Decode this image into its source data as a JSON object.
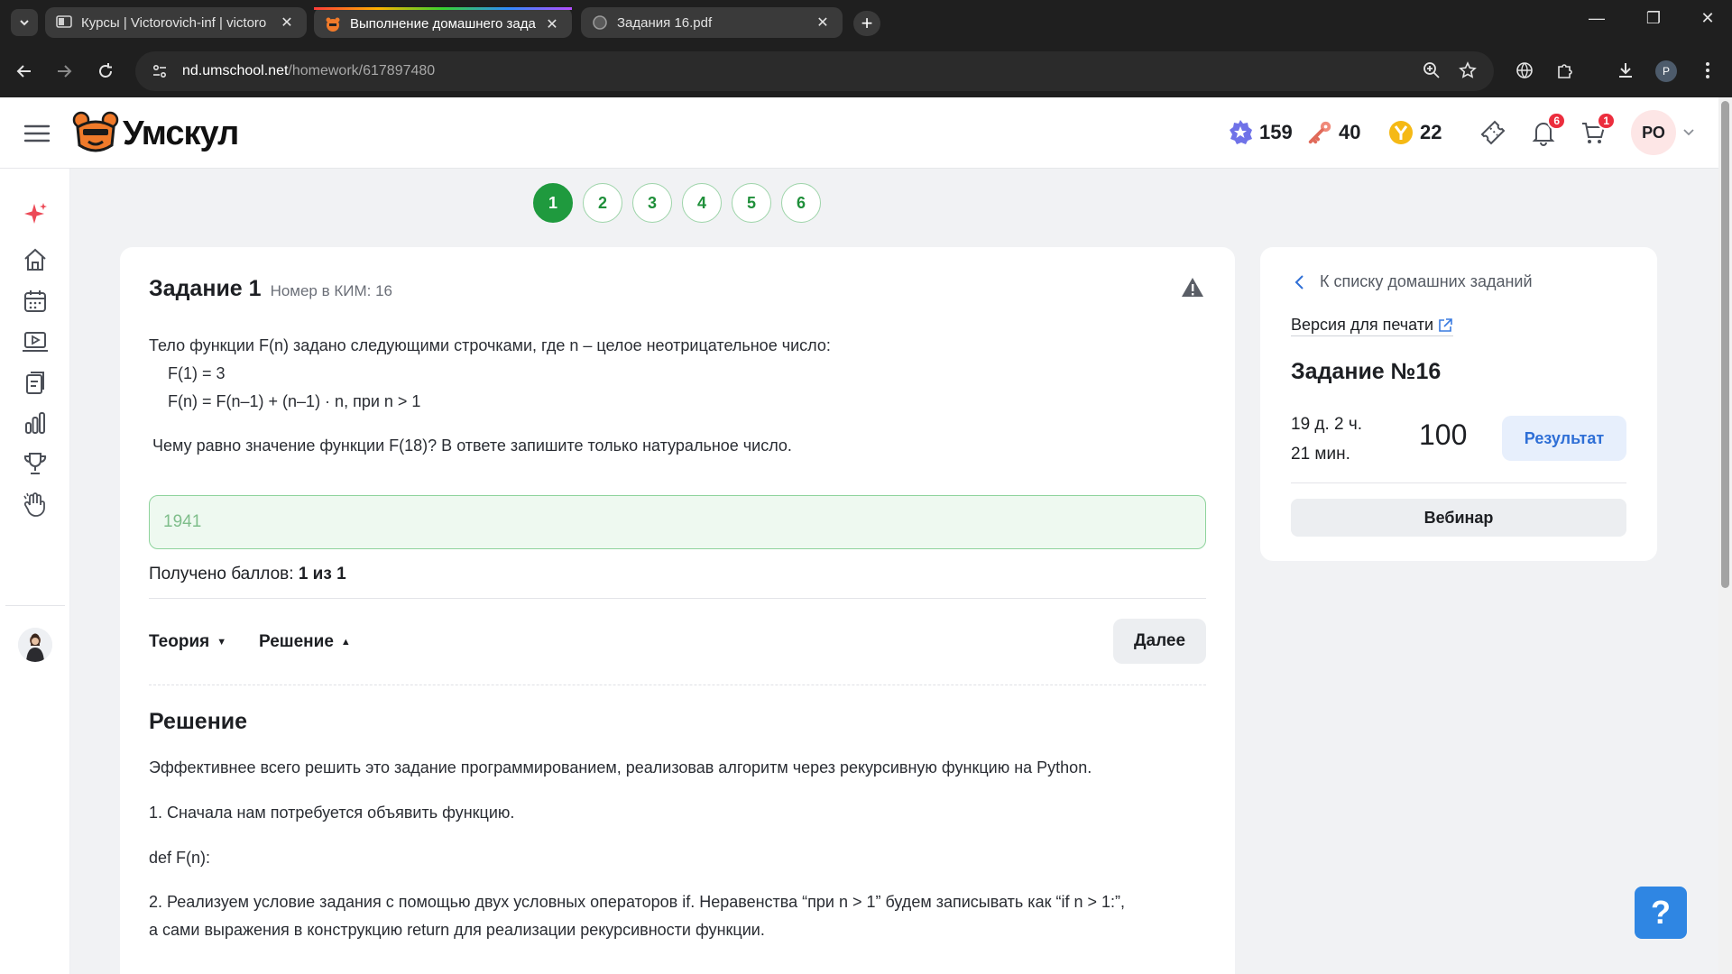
{
  "browser": {
    "tabs": [
      {
        "title": "Курсы | Victorovich-inf | victoro",
        "active": false
      },
      {
        "title": "Выполнение домашнего задан",
        "active": true
      },
      {
        "title": "Задания 16.pdf",
        "active": false
      }
    ],
    "url_host": "nd.umschool.net",
    "url_path": "/homework/617897480",
    "profile_initial": "P"
  },
  "header": {
    "logo_text": "Умскул",
    "stats": [
      {
        "icon": "star-badge-icon",
        "value": "159"
      },
      {
        "icon": "key-icon",
        "value": "40"
      },
      {
        "icon": "coin-icon",
        "value": "22"
      }
    ],
    "notifications_count": "6",
    "cart_count": "1",
    "avatar_initials": "РО"
  },
  "pagination": {
    "pages": [
      "1",
      "2",
      "3",
      "4",
      "5",
      "6"
    ],
    "active": "1"
  },
  "task": {
    "title": "Задание 1",
    "kim_number": "Номер в КИМ: 16",
    "condition_intro": "Тело функции F(n) задано следующими строчками, где n – целое неотрицательное число:",
    "condition_line1": "F(1) = 3",
    "condition_line2": "F(n) = F(n–1) + (n–1) · n, при n > 1",
    "question": "Чему равно значение функции F(18)? В ответе запишите только натуральное число.",
    "answer_value": "1941",
    "score_label": "Получено баллов:",
    "score_value": "1 из 1",
    "theory_label": "Теория",
    "solution_label": "Решение",
    "next_label": "Далее"
  },
  "solution": {
    "heading": "Решение",
    "p1": "Эффективнее всего решить это задание программированием, реализовав алгоритм через рекурсивную функцию на Python.",
    "p2": "1. Сначала нам потребуется объявить функцию.",
    "p3": "def F(n):",
    "p4a": "2. Реализуем условие задания с помощью двух условных операторов if. Неравенства “при n > 1” будем записывать как “if n > 1:”,",
    "p4b": "а сами выражения в конструкцию return для реализации рекурсивности функции."
  },
  "panel": {
    "back_label": "К списку домашних заданий",
    "print_label": "Версия для печати",
    "homework_title": "Задание №16",
    "deadline_line1": "19 д. 2 ч.",
    "deadline_line2": "21 мин.",
    "points": "100",
    "result_label": "Результат",
    "webinar_label": "Вебинар"
  },
  "help_label": "?"
}
